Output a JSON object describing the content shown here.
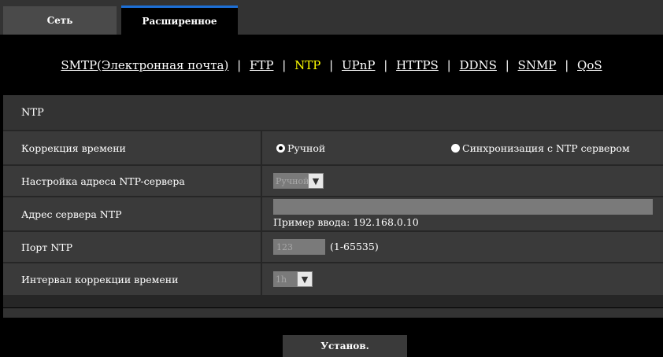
{
  "tabs": [
    {
      "label": "Сеть"
    },
    {
      "label": "Расширенное"
    }
  ],
  "nav": {
    "items": [
      "SMTP(Электронная почта)",
      "FTP",
      "NTP",
      "UPnP",
      "HTTPS",
      "DDNS",
      "SNMP",
      "QoS"
    ],
    "active": "NTP",
    "separator": "|"
  },
  "section": {
    "title": "NTP"
  },
  "fields": {
    "time_correction": {
      "label": "Коррекция времени",
      "option_manual": "Ручной",
      "option_ntp": "Синхронизация с NTP сервером",
      "selected": "Ручной"
    },
    "ntp_address_setting": {
      "label": "Настройка адреса NTP-сервера",
      "value": "Ручной"
    },
    "ntp_server_address": {
      "label": "Адрес сервера NTP",
      "value": "",
      "hint": "Пример ввода: 192.168.0.10"
    },
    "ntp_port": {
      "label": "Порт NTP",
      "value": "123",
      "range": "(1-65535)"
    },
    "correction_interval": {
      "label": "Интервал коррекции времени",
      "value": "1h"
    }
  },
  "buttons": {
    "set": "Установ."
  },
  "colors": {
    "active_nav": "#ffff00",
    "tab_accent": "#1d6fd6"
  }
}
